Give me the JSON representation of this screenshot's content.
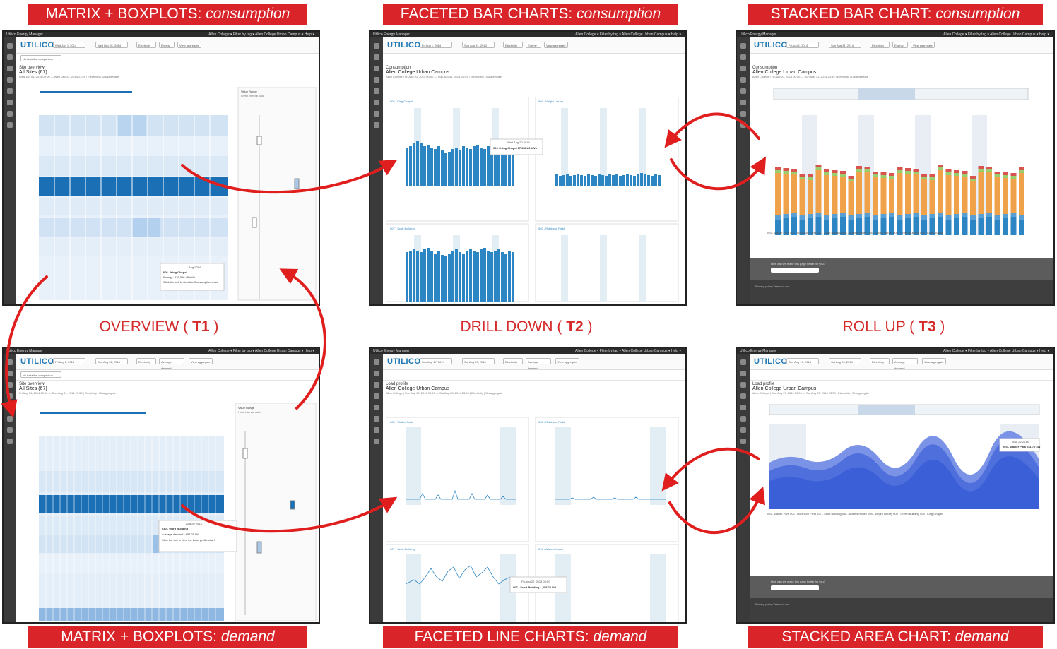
{
  "banners": {
    "top_left": {
      "main": "MATRIX + BOXPLOTS:",
      "ital": "consumption"
    },
    "top_mid": {
      "main": "FACETED BAR CHARTS:",
      "ital": "consumption"
    },
    "top_right": {
      "main": "STACKED BAR CHART:",
      "ital": "consumption"
    },
    "bot_left": {
      "main": "MATRIX + BOXPLOTS:",
      "ital": "demand"
    },
    "bot_mid": {
      "main": "FACETED LINE CHARTS:",
      "ital": "demand"
    },
    "bot_right": {
      "main": "STACKED AREA CHART:",
      "ital": "demand"
    }
  },
  "tasks": {
    "t1": {
      "text": "OVERVIEW (",
      "code": "T1",
      "close": ")"
    },
    "t2": {
      "text": "DRILL DOWN (",
      "code": "T2",
      "close": ")"
    },
    "t3": {
      "text": "ROLL UP (",
      "code": "T3",
      "close": ")"
    }
  },
  "app": {
    "title": "Utilico Energy Manager",
    "logo": "UTILICO",
    "menus": "Allen College ▾   Filter by tag ▾   Allen College Urban Campus ▾   Help ▾",
    "view_aggregate": "View aggregate",
    "electricity": "Electricity",
    "to": "to",
    "no_baseline": "No baseline comparison"
  },
  "shots": {
    "s1": {
      "date_from": "Wed Jan 1, 2014",
      "date_to": "Wed Dec 31, 2014",
      "metric": "Energy",
      "heading": "Site overview",
      "title": "All Sites (67)",
      "sub": "Wed Jan 01, 2014 00:00 — Wed Dec 31, 2014 23:59 | Electricity | Disaggregate",
      "tooltip_title": "Aug 2014",
      "tooltip_site": "006 - King Chapel",
      "tooltip_value": "Energy : 539,556.49 kWh",
      "tooltip_hint": "Click the cell to view the Consumption chart",
      "value_range": "Value Range",
      "value_sub": "Week interval data"
    },
    "s2": {
      "date_from": "Fri Aug 1, 2014",
      "date_to": "Sun Aug 31, 2014",
      "metric": "Energy",
      "heading": "Consumption",
      "title": "Allen College Urban Campus",
      "sub": "Allen College | Fri Aug 01, 2014 00:00 — Sun Aug 31, 2014 23:59 | Electricity | Disaggregate",
      "panels": [
        "006 - King Chapel",
        "004 - Wright Library",
        "007 - Scott Building",
        "002 - Robinson Field"
      ],
      "tooltip_date": "Wed Aug 20 2014",
      "tooltip_value": "006 - King Chapel  17,858.26 kWh"
    },
    "s3": {
      "date_from": "Fri Aug 1, 2014",
      "date_to": "Sun Aug 31, 2014",
      "metric": "Energy",
      "heading": "Consumption",
      "title": "Allen College Urban Campus",
      "sub": "Allen College | Fri Aug 01, 2014 00:00 — Sun Aug 31, 2014 23:59 | Electricity | Disaggregate",
      "legend": "003 - Walker Park   002 - Robinson Field   007 - Scott Building   018 - Adams House   004 - Wright Library   008 - Green Building   006 - King Chapel",
      "feedback": "How can we make this page better for you?",
      "privacy": "Privacy policy    Terms of use"
    },
    "s4": {
      "date_from": "Fri Aug 1, 2014",
      "date_to": "Sun Aug 31, 2014",
      "metric": "Average demand",
      "heading": "Site overview",
      "title": "All Sites (67)",
      "sub": "Fri Aug 01, 2014 00:00 — Sun Aug 31, 2014 23:59 | Electricity | Disaggregate",
      "tooltip_title": "Aug 20 2014",
      "tooltip_site": "030 - Ward Building",
      "tooltip_value": "Average demand : 657.25 kW",
      "tooltip_hint": "Click the cell to view the Load profile chart",
      "value_range": "Value Range",
      "value_sub": "Hour interval data"
    },
    "s5": {
      "date_from": "Sun Aug 17, 2014",
      "date_to": "Sat Aug 23, 2014",
      "metric": "Average demand",
      "heading": "Load profile",
      "title": "Allen College Urban Campus",
      "sub": "Allen College | Sun Aug 17, 2014 00:00 — Sat Aug 23, 2014 23:59 | Electricity | Disaggregate",
      "panels": [
        "003 - Walker Park",
        "002 - Robinson Field",
        "007 - Scott Building",
        "018 - Adams House"
      ],
      "tooltip_date": "Fri Aug 22, 2014 09:00",
      "tooltip_value": "007 - Scott Building  1,358.72 kW"
    },
    "s6": {
      "date_from": "Sun Aug 17, 2014",
      "date_to": "Sat Aug 23, 2014",
      "metric": "Average demand",
      "heading": "Load profile",
      "title": "Allen College Urban Campus",
      "sub": "Allen College | Sun Aug 17, 2014 00:00 — Sat Aug 23, 2014 23:59 | Electricity | Disaggregate",
      "tooltip_date": "Aug 22 2014",
      "tooltip_value": "003 - Walker Park  241.70 kW",
      "legend": "003 - Walker Park   002 - Robinson Field   007 - Scott Building   018 - Adams House   004 - Wright Library   008 - Green Building   006 - King Chapel",
      "feedback": "How can we make this page better for you?",
      "privacy": "Privacy policy    Terms of use"
    }
  },
  "colors": {
    "accent": "#d9252a",
    "bar_blue": "#2d86c4",
    "heat_dark": "#1b6fb5",
    "heat_light": "#e4eff9",
    "stack_orange": "#f0a24a",
    "area_blue": "#3b5fd6"
  }
}
